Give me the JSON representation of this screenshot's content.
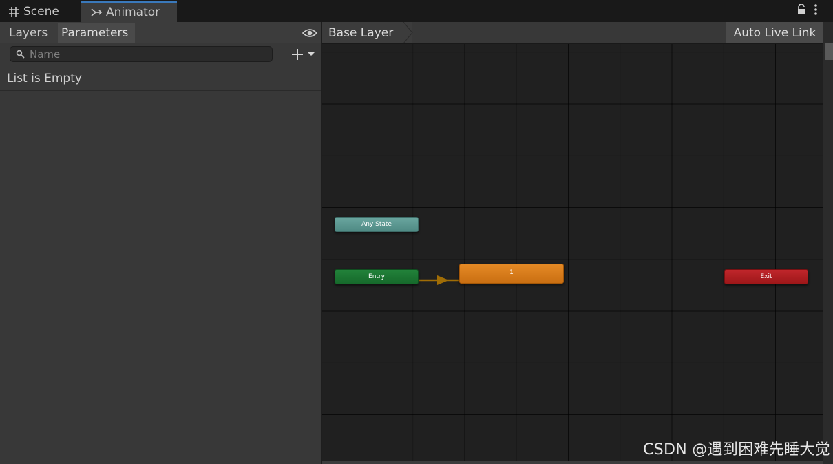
{
  "tabs": [
    {
      "label": "Scene",
      "icon": "grid-hash-icon",
      "active": false
    },
    {
      "label": "Animator",
      "icon": "animator-branch-icon",
      "active": true
    }
  ],
  "window_icons": [
    "lock-icon",
    "kebab-menu-icon"
  ],
  "left_panel": {
    "tabs": [
      "Layers",
      "Parameters"
    ],
    "active_tab": "Parameters",
    "visibility_icon": "eye-icon",
    "search": {
      "placeholder": "Name",
      "value": ""
    },
    "add_icon": "plus-dropdown-icon",
    "empty_text": "List is Empty"
  },
  "graph": {
    "breadcrumb": "Base Layer",
    "live_link_label": "Auto Live Link",
    "nodes": {
      "any_state": "Any State",
      "entry": "Entry",
      "default_state": "1",
      "exit": "Exit"
    },
    "colors": {
      "any_state": "#5a948e",
      "entry": "#1c7a33",
      "default_state": "#da7e1c",
      "exit": "#b01f22",
      "transition": "#a06d06"
    }
  },
  "watermark": "CSDN @遇到困难先睡大觉"
}
